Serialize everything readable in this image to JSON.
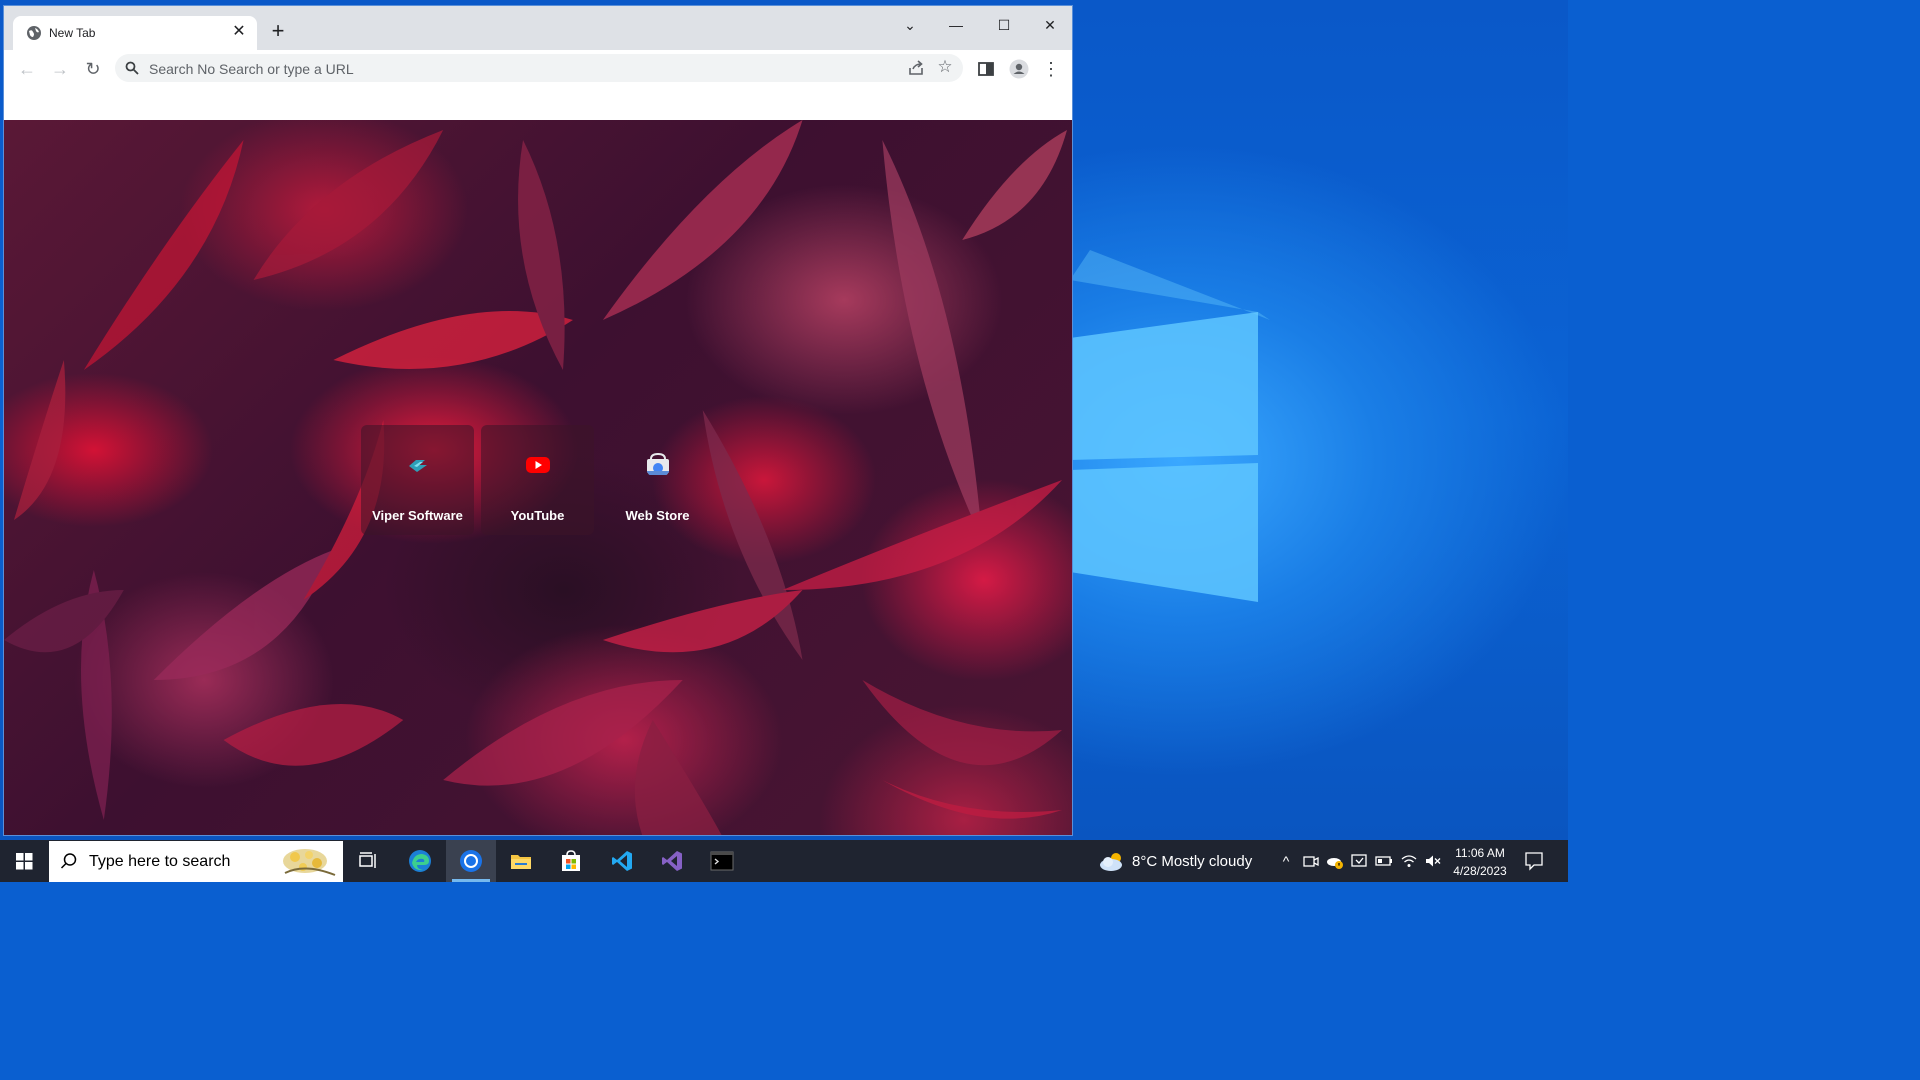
{
  "browser": {
    "tab": {
      "title": "New Tab",
      "close_glyph": "✕",
      "icon": "globe-icon"
    },
    "new_tab_glyph": "+",
    "window_controls": {
      "tab_search": "⌄",
      "minimize": "—",
      "maximize": "☐",
      "close": "✕"
    },
    "toolbar": {
      "back": "←",
      "forward": "→",
      "reload": "↻",
      "omnibox_text": "Search No Search or type a URL",
      "star": "☆",
      "menu": "⋮"
    },
    "shortcuts": [
      {
        "label": "Viper Software",
        "icon": "viper-software-icon"
      },
      {
        "label": "YouTube",
        "icon": "youtube-icon",
        "color": "#ff0000"
      },
      {
        "label": "Web Store",
        "icon": "web-store-icon"
      }
    ]
  },
  "taskbar": {
    "search_placeholder": "Type here to search",
    "apps": [
      "task-view-icon",
      "edge-icon",
      "chrome-icon",
      "file-explorer-icon",
      "microsoft-store-icon",
      "vscode-icon",
      "visual-studio-icon",
      "terminal-icon"
    ],
    "active_app": "chrome-icon",
    "weather": {
      "text": "8°C  Mostly cloudy"
    },
    "tray_chevron": "^",
    "clock": {
      "time": "11:06 AM",
      "date": "4/28/2023"
    }
  },
  "colors": {
    "desktop_blue": "#0a5fd0",
    "taskbar": "#1f2430",
    "tabstrip": "#dee1e6",
    "youtube_red": "#ff0000",
    "taskbar_accent": "#76b9ed"
  }
}
